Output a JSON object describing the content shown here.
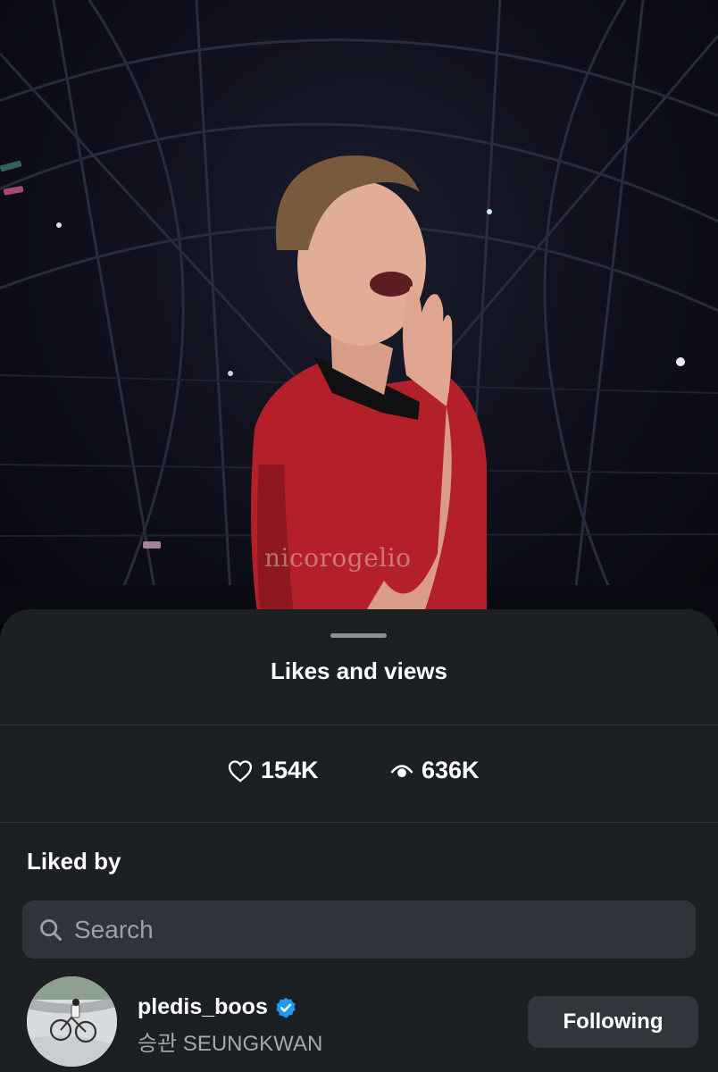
{
  "photo": {
    "watermark": "nicorogelio"
  },
  "sheet": {
    "title": "Likes and views",
    "stats": {
      "likes": "154K",
      "views": "636K"
    },
    "liked_by_label": "Liked by",
    "search": {
      "placeholder": "Search"
    },
    "users": [
      {
        "username": "pledis_boos",
        "display_name": "승관 SEUNGKWAN",
        "verified": true,
        "button_label": "Following"
      }
    ]
  },
  "colors": {
    "sheet_bg": "#1c2025",
    "search_bg": "#2f343a",
    "button_bg": "#31363c",
    "verified_blue": "#1d9bf0"
  },
  "icons": [
    "heart-icon",
    "eye-icon",
    "search-icon",
    "verified-badge-icon"
  ]
}
